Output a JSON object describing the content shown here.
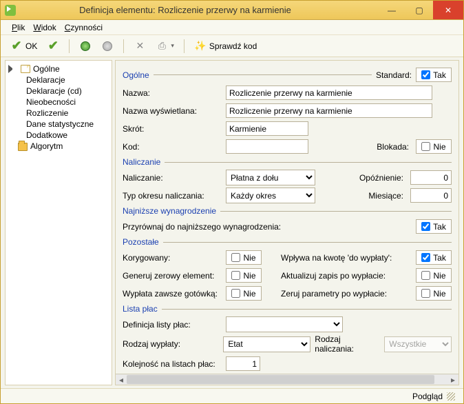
{
  "window": {
    "title": "Definicja elementu: Rozliczenie przerwy na karmienie"
  },
  "menu": {
    "plik": "Plik",
    "widok": "Widok",
    "czynnosci": "Czynności"
  },
  "toolbar": {
    "ok": "OK",
    "sprawdz": "Sprawdź kod"
  },
  "tree": {
    "root": "Ogólne",
    "items": [
      "Deklaracje",
      "Deklaracje (cd)",
      "Nieobecności",
      "Rozliczenie",
      "Dane statystyczne",
      "Dodatkowe"
    ],
    "algorytm": "Algorytm"
  },
  "groups": {
    "ogolne": "Ogólne",
    "naliczanie": "Naliczanie",
    "najnizsze": "Najniższe wynagrodzenie",
    "pozostale": "Pozostałe",
    "listaplac": "Lista płac"
  },
  "labels": {
    "standard": "Standard:",
    "nazwa": "Nazwa:",
    "nazwa_wys": "Nazwa wyświetlana:",
    "skrot": "Skrót:",
    "kod": "Kod:",
    "blokada": "Blokada:",
    "naliczanie": "Naliczanie:",
    "opoznienie": "Opóźnienie:",
    "typ_okresu": "Typ okresu naliczania:",
    "miesiace": "Miesiące:",
    "przyrownaj": "Przyrównaj do najniższego wynagrodzenia:",
    "korygowany": "Korygowany:",
    "generuj_zero": "Generuj zerowy element:",
    "wyplata_gotowka": "Wypłata zawsze gotówką:",
    "wplywa": "Wpływa na  kwotę 'do wypłaty':",
    "aktualizuj": "Aktualizuj zapis po wypłacie:",
    "zeruj": "Zeruj parametry po wypłacie:",
    "def_listy": "Definicja listy płac:",
    "rodzaj_wyp": "Rodzaj wypłaty:",
    "rodzaj_nal": "Rodzaj naliczania:",
    "kolejnosc": "Kolejność na listach płac:"
  },
  "vals": {
    "tak": "Tak",
    "nie": "Nie",
    "nazwa": "Rozliczenie przerwy na karmienie",
    "nazwa_wys": "Rozliczenie przerwy na karmienie",
    "skrot": "Karmienie",
    "kod": "",
    "naliczanie_sel": "Płatna z dołu",
    "typ_okresu_sel": "Każdy okres",
    "opoznienie": "0",
    "miesiace": "0",
    "def_listy_sel": "",
    "rodzaj_wyp_sel": "Etat",
    "rodzaj_nal_sel": "Wszystkie",
    "kolejnosc": "1"
  },
  "status": {
    "podglad": "Podgląd"
  }
}
